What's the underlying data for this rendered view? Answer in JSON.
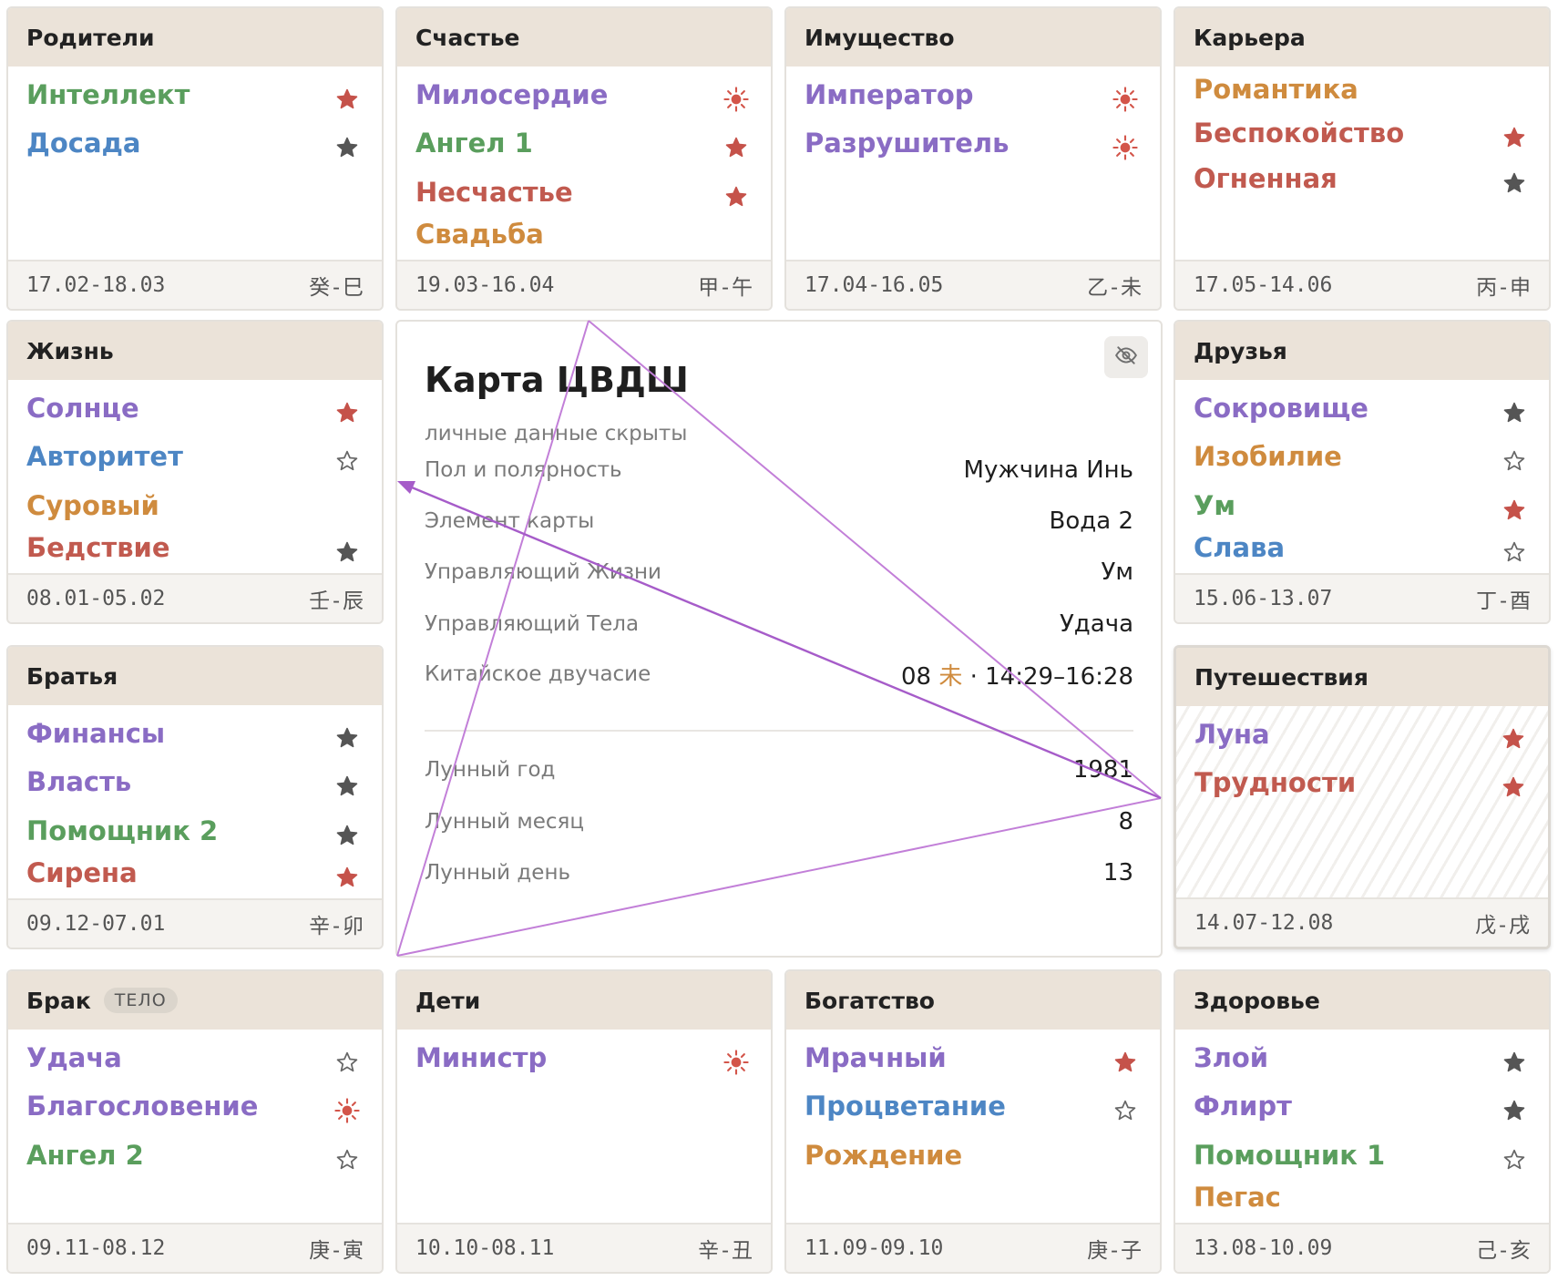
{
  "palaces": [
    {
      "name": "Родители",
      "badge": "",
      "dates": "17.02-18.03",
      "ganzhi": "癸-巳",
      "stars": [
        {
          "name": "Интеллект",
          "color": "green",
          "mark": "star-red"
        },
        {
          "name": "Досада",
          "color": "blue",
          "mark": "star-dark"
        }
      ]
    },
    {
      "name": "Счастье",
      "badge": "",
      "dates": "19.03-16.04",
      "ganzhi": "甲-午",
      "stars": [
        {
          "name": "Милосердие",
          "color": "purple",
          "mark": "sun"
        },
        {
          "name": "Ангел 1",
          "color": "green",
          "mark": "star-red"
        },
        {
          "name": "Несчастье",
          "color": "red",
          "mark": "star-red"
        },
        {
          "name": "Свадьба",
          "color": "orange",
          "mark": ""
        }
      ]
    },
    {
      "name": "Имущество",
      "badge": "",
      "dates": "17.04-16.05",
      "ganzhi": "乙-未",
      "stars": [
        {
          "name": "Император",
          "color": "purple",
          "mark": "sun"
        },
        {
          "name": "Разрушитель",
          "color": "purple",
          "mark": "sun"
        }
      ]
    },
    {
      "name": "Карьера",
      "badge": "",
      "dates": "17.05-14.06",
      "ganzhi": "丙-申",
      "stars": [
        {
          "name": "Романтика",
          "color": "orange",
          "mark": ""
        },
        {
          "name": "Беспокойство",
          "color": "red",
          "mark": "star-red"
        },
        {
          "name": "Огненная",
          "color": "red",
          "mark": "star-dark"
        }
      ]
    },
    {
      "name": "Жизнь",
      "badge": "",
      "dates": "08.01-05.02",
      "ganzhi": "壬-辰",
      "stars": [
        {
          "name": "Солнце",
          "color": "purple",
          "mark": "star-red"
        },
        {
          "name": "Авторитет",
          "color": "blue",
          "mark": "star-outline"
        },
        {
          "name": "Суровый",
          "color": "orange",
          "mark": ""
        },
        {
          "name": "Бедствие",
          "color": "red",
          "mark": "star-dark"
        }
      ]
    },
    {
      "name": "Друзья",
      "badge": "",
      "dates": "15.06-13.07",
      "ganzhi": "丁-酉",
      "stars": [
        {
          "name": "Сокровище",
          "color": "purple",
          "mark": "star-dark"
        },
        {
          "name": "Изобилие",
          "color": "orange",
          "mark": "star-outline"
        },
        {
          "name": "Ум",
          "color": "green",
          "mark": "star-red"
        },
        {
          "name": "Слава",
          "color": "blue",
          "mark": "star-outline"
        }
      ]
    },
    {
      "name": "Братья",
      "badge": "",
      "dates": "09.12-07.01",
      "ganzhi": "辛-卯",
      "stars": [
        {
          "name": "Финансы",
          "color": "purple",
          "mark": "star-dark"
        },
        {
          "name": "Власть",
          "color": "purple",
          "mark": "star-dark"
        },
        {
          "name": "Помощник 2",
          "color": "green",
          "mark": "star-dark"
        },
        {
          "name": "Сирена",
          "color": "red",
          "mark": "star-red"
        }
      ]
    },
    {
      "name": "Путешествия",
      "badge": "",
      "dates": "14.07-12.08",
      "ganzhi": "戊-戌",
      "stars": [
        {
          "name": "Луна",
          "color": "purple",
          "mark": "star-red"
        },
        {
          "name": "Трудности",
          "color": "red",
          "mark": "star-red"
        }
      ]
    },
    {
      "name": "Брак",
      "badge": "ТЕЛО",
      "dates": "09.11-08.12",
      "ganzhi": "庚-寅",
      "stars": [
        {
          "name": "Удача",
          "color": "purple",
          "mark": "star-outline"
        },
        {
          "name": "Благословение",
          "color": "purple",
          "mark": "sun"
        },
        {
          "name": "Ангел 2",
          "color": "green",
          "mark": "star-outline"
        }
      ]
    },
    {
      "name": "Дети",
      "badge": "",
      "dates": "10.10-08.11",
      "ganzhi": "辛-丑",
      "stars": [
        {
          "name": "Министр",
          "color": "purple",
          "mark": "sun"
        }
      ]
    },
    {
      "name": "Богатство",
      "badge": "",
      "dates": "11.09-09.10",
      "ganzhi": "庚-子",
      "stars": [
        {
          "name": "Мрачный",
          "color": "purple",
          "mark": "star-red"
        },
        {
          "name": "Процветание",
          "color": "blue",
          "mark": "star-outline"
        },
        {
          "name": "Рождение",
          "color": "orange",
          "mark": ""
        }
      ]
    },
    {
      "name": "Здоровье",
      "badge": "",
      "dates": "13.08-10.09",
      "ganzhi": "己-亥",
      "stars": [
        {
          "name": "Злой",
          "color": "purple",
          "mark": "star-dark"
        },
        {
          "name": "Флирт",
          "color": "purple",
          "mark": "star-dark"
        },
        {
          "name": "Помощник 1",
          "color": "green",
          "mark": "star-outline"
        },
        {
          "name": "Пегас",
          "color": "orange",
          "mark": ""
        }
      ]
    }
  ],
  "center": {
    "title": "Карта ЦВДШ",
    "subtitle": "личные данные скрыты",
    "hide_icon": "eye-off-icon",
    "rows": [
      {
        "label": "Пол и полярность",
        "value": "Мужчина Инь"
      },
      {
        "label": "Элемент карты",
        "value": "Вода 2"
      },
      {
        "label": "Управляющий Жизни",
        "value": "Ум"
      },
      {
        "label": "Управляющий Тела",
        "value": "Удача"
      }
    ],
    "hour": {
      "label": "Китайское двучасие",
      "num": "08",
      "glyph": "未",
      "sep": " · ",
      "range": "14:29–16:28"
    },
    "lunar": [
      {
        "label": "Лунный год",
        "value": "1981"
      },
      {
        "label": "Лунный месяц",
        "value": "8"
      },
      {
        "label": "Лунный день",
        "value": "13"
      }
    ]
  },
  "colors": {
    "purple": "#8a6cc4",
    "green": "#5a9e5d",
    "blue": "#4d86c4",
    "red": "#c15a4f",
    "orange": "#cf8b3e",
    "star_red": "#c5524a",
    "star_dark": "#555555",
    "sun": "#d3554a",
    "triangle": "#c27fd8",
    "arrow": "#a65cc9"
  }
}
